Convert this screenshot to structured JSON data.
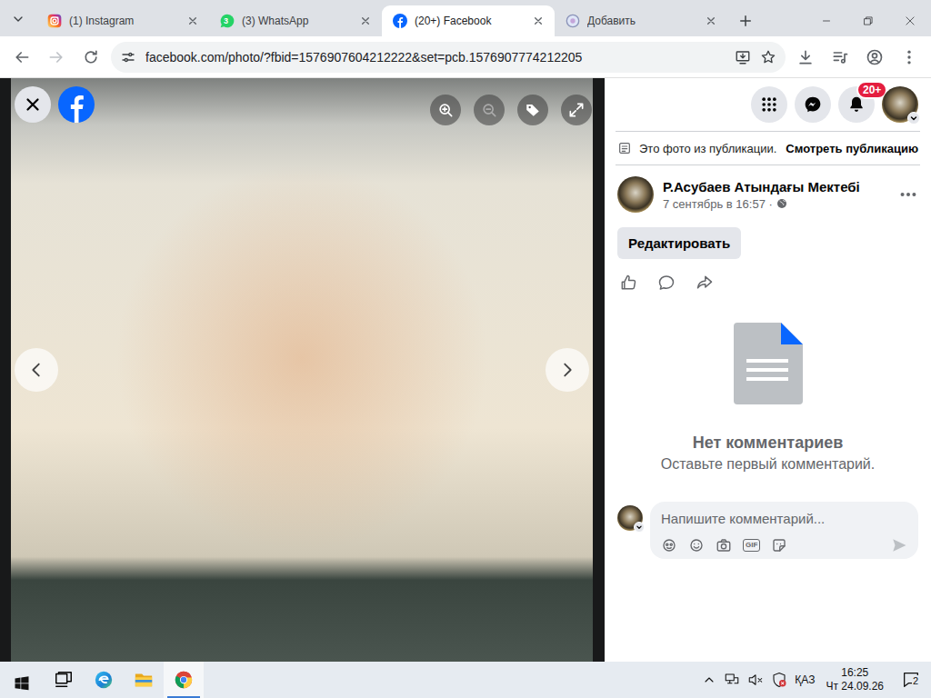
{
  "browser": {
    "tabs": [
      {
        "label": "(1) Instagram",
        "kind": "instagram",
        "selected": false
      },
      {
        "label": "(3) WhatsApp",
        "kind": "whatsapp",
        "badge": "3",
        "selected": false
      },
      {
        "label": "(20+) Facebook",
        "kind": "facebook",
        "selected": true
      },
      {
        "label": "Добавить",
        "kind": "generic",
        "selected": false
      }
    ],
    "address": {
      "url": "facebook.com/photo/?fbid=1576907604212222&set=pcb.1576907774212205"
    }
  },
  "header": {
    "notifications_badge": "20+"
  },
  "post": {
    "notice": "Это фото из публикации.",
    "view_post": "Смотреть публикацию",
    "author": "Р.Асубаев Атындағы Мектебі",
    "date": "7 сентябрь в 16:57 ·",
    "edit_button": "Редактировать",
    "empty_title": "Нет комментариев",
    "empty_hint": "Оставьте первый комментарий."
  },
  "comment": {
    "placeholder": "Напишите комментарий...",
    "gif_label": "GIF"
  },
  "taskbar": {
    "apps": [
      {
        "kind": "task-view",
        "selected": false
      },
      {
        "kind": "edge",
        "selected": false
      },
      {
        "kind": "explorer",
        "selected": false
      },
      {
        "kind": "chrome",
        "selected": true
      }
    ],
    "language": "ҚАЗ",
    "time": "16:25",
    "date": "Чт 24.09.26",
    "notifications": "2"
  }
}
